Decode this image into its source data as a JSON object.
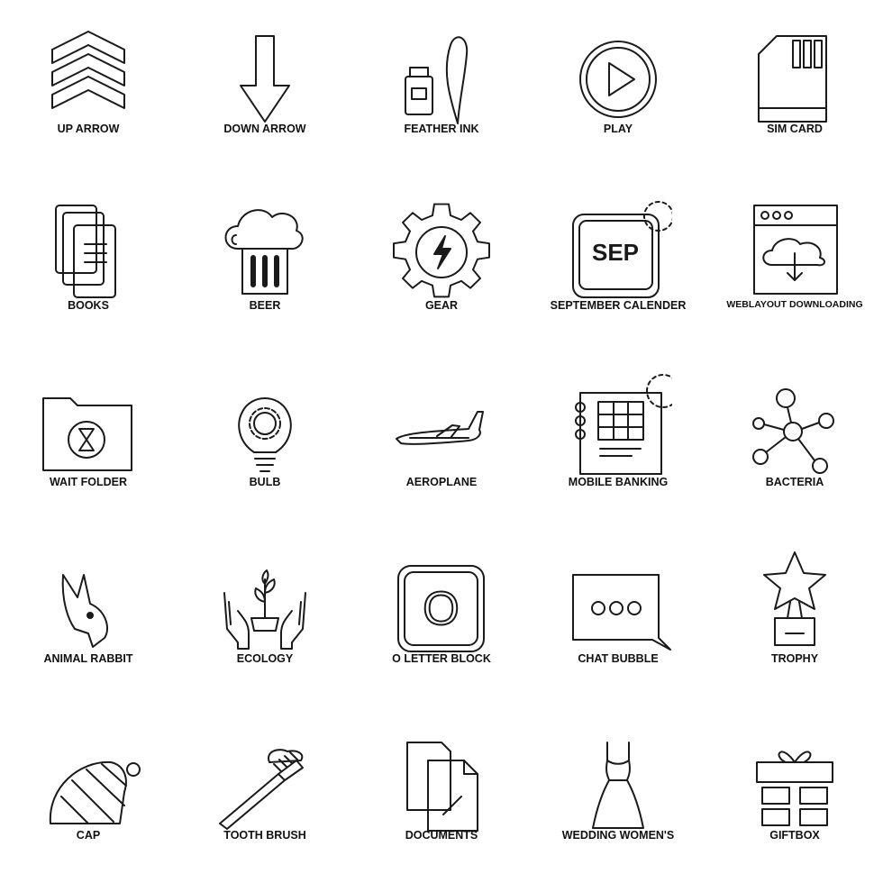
{
  "icons": [
    {
      "label": "UP ARROW",
      "icon": "up-arrow-icon"
    },
    {
      "label": "DOWN ARROW",
      "icon": "down-arrow-icon"
    },
    {
      "label": "FEATHER INK",
      "icon": "feather-ink-icon"
    },
    {
      "label": "PLAY",
      "icon": "play-icon"
    },
    {
      "label": "SIM CARD",
      "icon": "sim-card-icon"
    },
    {
      "label": "BOOKS",
      "icon": "books-icon"
    },
    {
      "label": "BEER",
      "icon": "beer-icon"
    },
    {
      "label": "GEAR",
      "icon": "gear-icon"
    },
    {
      "label": "SEPTEMBER CALENDER",
      "icon": "september-calendar-icon",
      "text": "SEP"
    },
    {
      "label": "WEBLAYOUT DOWNLOADING",
      "icon": "weblayout-downloading-icon"
    },
    {
      "label": "WAIT FOLDER",
      "icon": "wait-folder-icon"
    },
    {
      "label": "BULB",
      "icon": "bulb-icon"
    },
    {
      "label": "AEROPLANE",
      "icon": "aeroplane-icon"
    },
    {
      "label": "MOBILE BANKING",
      "icon": "mobile-banking-icon"
    },
    {
      "label": "BACTERIA",
      "icon": "bacteria-icon"
    },
    {
      "label": "ANIMAL RABBIT",
      "icon": "rabbit-icon"
    },
    {
      "label": "ECOLOGY",
      "icon": "ecology-icon"
    },
    {
      "label": "O LETTER BLOCK",
      "icon": "o-letter-block-icon",
      "text": "O"
    },
    {
      "label": "CHAT BUBBLE",
      "icon": "chat-bubble-icon"
    },
    {
      "label": "TROPHY",
      "icon": "trophy-icon"
    },
    {
      "label": "CAP",
      "icon": "cap-icon"
    },
    {
      "label": "TOOTH BRUSH",
      "icon": "tooth-brush-icon"
    },
    {
      "label": "DOCUMENTS",
      "icon": "documents-icon"
    },
    {
      "label": "WEDDING WOMEN'S",
      "icon": "wedding-dress-icon"
    },
    {
      "label": "GIFTBOX",
      "icon": "giftbox-icon"
    }
  ]
}
